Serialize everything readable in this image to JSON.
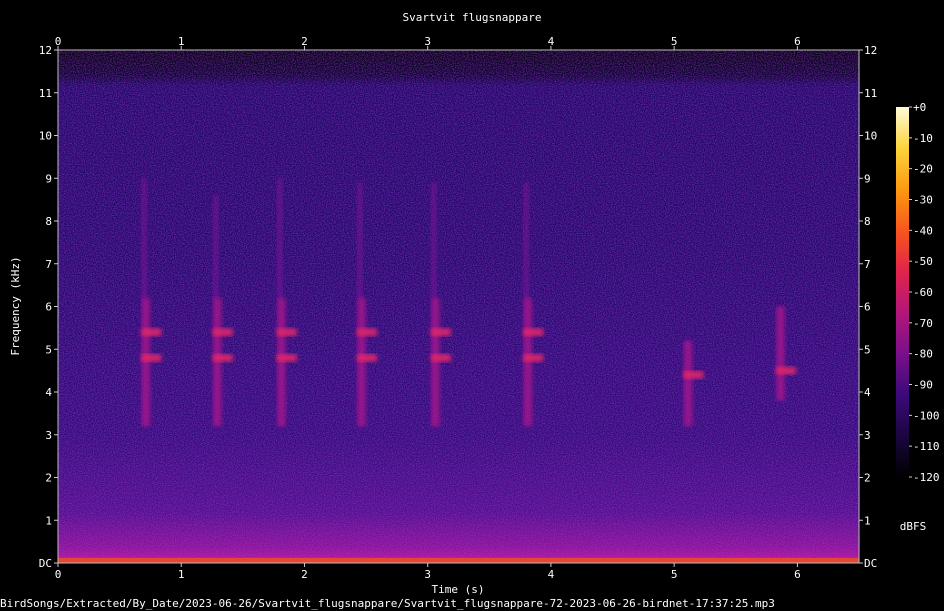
{
  "chart_data": {
    "type": "heatmap",
    "title": "Svartvit flugsnappare",
    "xlabel": "Time (s)",
    "ylabel": "Frequency (kHz)",
    "xlim": [
      0,
      6.5
    ],
    "ylim": [
      0,
      12
    ],
    "x_ticks": [
      "0",
      "1",
      "2",
      "3",
      "4",
      "5",
      "6"
    ],
    "y_ticks": [
      "DC",
      "1",
      "2",
      "3",
      "4",
      "5",
      "6",
      "7",
      "8",
      "9",
      "10",
      "11",
      "12"
    ],
    "colorbar": {
      "unit": "dBFS",
      "range": [
        -120,
        0
      ],
      "ticks": [
        "+0",
        "-10",
        "-20",
        "-30",
        "-40",
        "-50",
        "-60",
        "-70",
        "-80",
        "-90",
        "-100",
        "-110",
        "-120"
      ],
      "colors": [
        "#000000",
        "#1a0640",
        "#3c0a7a",
        "#7a0f8a",
        "#b3167a",
        "#e0244a",
        "#f8561c",
        "#fc9a10",
        "#fcd43c",
        "#fffbd8"
      ]
    },
    "calls": [
      {
        "t": 0.7,
        "f_low": 3.2,
        "f_high": 9.0,
        "peak_khz": [
          5.4,
          4.8
        ]
      },
      {
        "t": 1.28,
        "f_low": 3.2,
        "f_high": 8.6,
        "peak_khz": [
          5.4,
          4.8
        ]
      },
      {
        "t": 1.8,
        "f_low": 3.2,
        "f_high": 9.0,
        "peak_khz": [
          5.4,
          4.8
        ]
      },
      {
        "t": 2.45,
        "f_low": 3.2,
        "f_high": 8.9,
        "peak_khz": [
          5.4,
          4.8
        ]
      },
      {
        "t": 3.05,
        "f_low": 3.2,
        "f_high": 8.9,
        "peak_khz": [
          5.4,
          4.8
        ]
      },
      {
        "t": 3.8,
        "f_low": 3.2,
        "f_high": 8.9,
        "peak_khz": [
          5.4,
          4.8
        ]
      },
      {
        "t": 5.1,
        "f_low": 3.2,
        "f_high": 5.2,
        "peak_khz": [
          4.4
        ]
      },
      {
        "t": 5.85,
        "f_low": 3.8,
        "f_high": 6.0,
        "peak_khz": [
          4.5
        ]
      }
    ]
  },
  "footer": {
    "path": "BirdSongs/Extracted/By_Date/2023-06-26/Svartvit_flugsnappare/Svartvit_flugsnappare-72-2023-06-26-birdnet-17:37:25.mp3"
  }
}
